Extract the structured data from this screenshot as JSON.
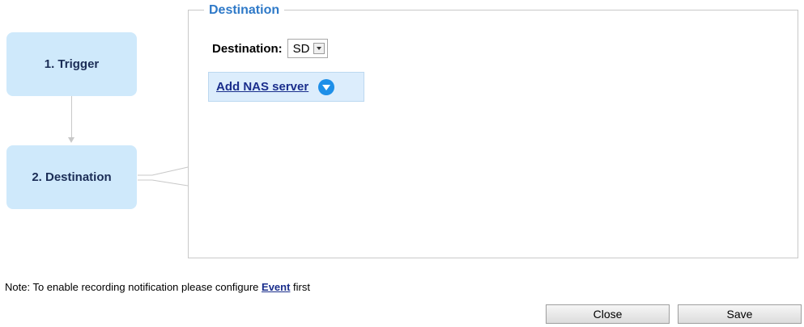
{
  "steps": [
    {
      "label": "1.  Trigger"
    },
    {
      "label": "2.  Destination"
    }
  ],
  "section": {
    "legend": "Destination"
  },
  "destination": {
    "label": "Destination:",
    "selected": "SD"
  },
  "nas": {
    "link_label": "Add NAS server"
  },
  "note": {
    "prefix": "Note: To enable recording notification please configure ",
    "link": "Event",
    "suffix": " first"
  },
  "buttons": {
    "close": "Close",
    "save": "Save"
  },
  "colors": {
    "step_bg": "#cfe9fb",
    "legend": "#2e79c8",
    "nas_bg": "#dcedfc",
    "link": "#1a2e8c",
    "icon": "#1e8fe8"
  }
}
